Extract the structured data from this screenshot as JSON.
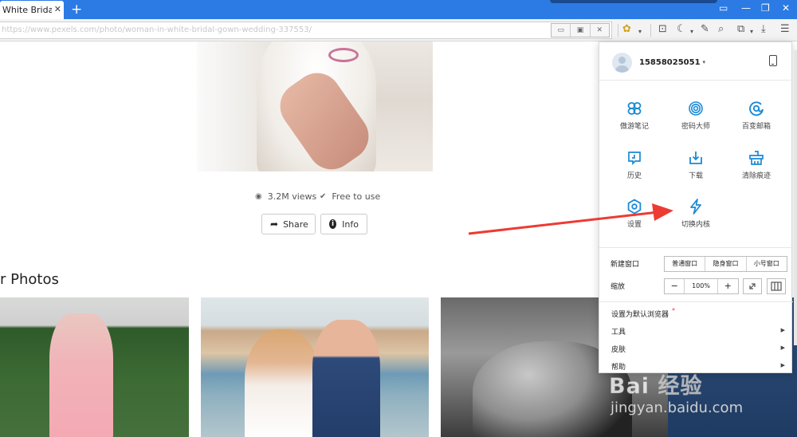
{
  "browser": {
    "tab_title": "White Bridal G",
    "tab_close": "✕",
    "new_tab": "+",
    "url_blurred": "https://www.pexels.com/photo/woman-in-white-bridal-gown-wedding-337553/"
  },
  "photo_page": {
    "views": "3.2M views",
    "license": "Free to use",
    "share_label": "Share",
    "info_label": "Info",
    "info_icon_glyph": "i",
    "section_title": "r Photos"
  },
  "menu": {
    "username": "15858025051",
    "grid": [
      {
        "label": "傲游笔记",
        "icon": "notes-icon"
      },
      {
        "label": "密码大师",
        "icon": "fingerprint-icon"
      },
      {
        "label": "百变邮箱",
        "icon": "mail-icon"
      },
      {
        "label": "历史",
        "icon": "history-icon"
      },
      {
        "label": "下载",
        "icon": "download-icon"
      },
      {
        "label": "清除痕迹",
        "icon": "clear-traces-icon"
      },
      {
        "label": "设置",
        "icon": "settings-icon"
      },
      {
        "label": "切换内核",
        "icon": "lightning-icon"
      }
    ],
    "new_window_label": "新建窗口",
    "window_modes": [
      "普通窗口",
      "隐身窗口",
      "小号窗口"
    ],
    "zoom_label": "缩放",
    "zoom_minus": "−",
    "zoom_value": "100%",
    "zoom_plus": "+",
    "list": [
      {
        "label": "设置为默认浏览器",
        "marker": "*"
      },
      {
        "label": "工具",
        "submenu": true
      },
      {
        "label": "皮肤",
        "submenu": true
      },
      {
        "label": "帮助",
        "submenu": true
      }
    ],
    "submenu_arrow": "▶",
    "accent_color": "#1a8ad6"
  },
  "watermark": {
    "main": "Bai 经验",
    "sub": "jingyan.baidu.com"
  }
}
